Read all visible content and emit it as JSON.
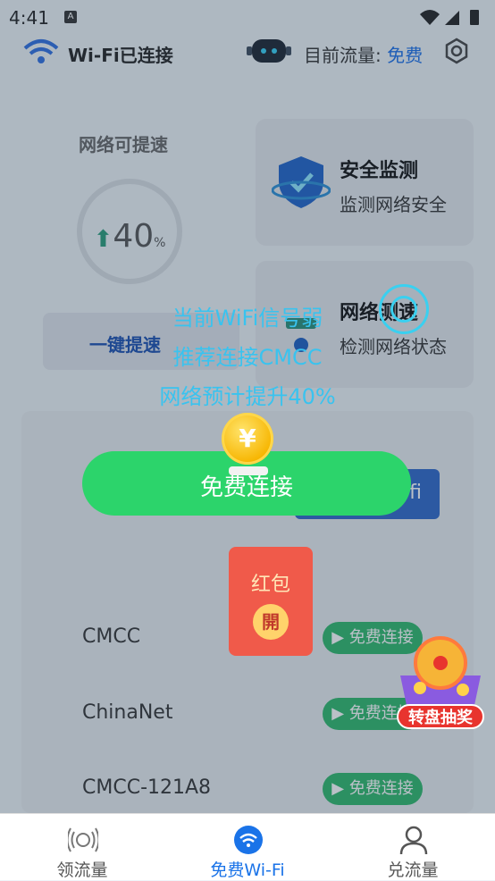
{
  "status_bar": {
    "time": "4:41",
    "notification_icon": "A"
  },
  "header": {
    "connection_label": "Wi-Fi已连接",
    "flow_label": "目前流量:",
    "flow_value": "免费"
  },
  "boost_panel": {
    "title": "网络可提速",
    "percent": "40",
    "percent_unit": "%",
    "button_label": "一键提速"
  },
  "cards": [
    {
      "title": "安全监测",
      "subtitle": "监测网络安全",
      "icon": "shield-icon"
    },
    {
      "title": "网络测速",
      "subtitle": "检测网络状态",
      "icon": "speed-icon"
    }
  ],
  "hidden_button_label": "fi",
  "wifi_list": [
    {
      "name": "CMCC",
      "action": "▶ 免费连接"
    },
    {
      "name": "ChinaNet",
      "action": "▶ 免费连接"
    },
    {
      "name": "CMCC-121A8",
      "action": "▶ 免费连接"
    }
  ],
  "popup": {
    "line1": "当前WiFi信号弱",
    "line2": "推荐连接CMCC",
    "line3": "网络预计提升40%",
    "coin_symbol": "¥",
    "button_label": "免费连接"
  },
  "red_packet": {
    "title": "红包",
    "open_label": "開"
  },
  "lottery": {
    "label": "转盘抽奖"
  },
  "tabs": [
    {
      "label": "领流量",
      "icon": "signal-coin-icon",
      "active": false
    },
    {
      "label": "免费Wi-Fi",
      "icon": "wifi-icon",
      "active": true
    },
    {
      "label": "兑流量",
      "icon": "person-icon",
      "active": false
    }
  ],
  "colors": {
    "accent": "#1a73e8",
    "green": "#2cd46b",
    "popup_text": "#39c3ef",
    "red_packet": "#f05a4a"
  }
}
